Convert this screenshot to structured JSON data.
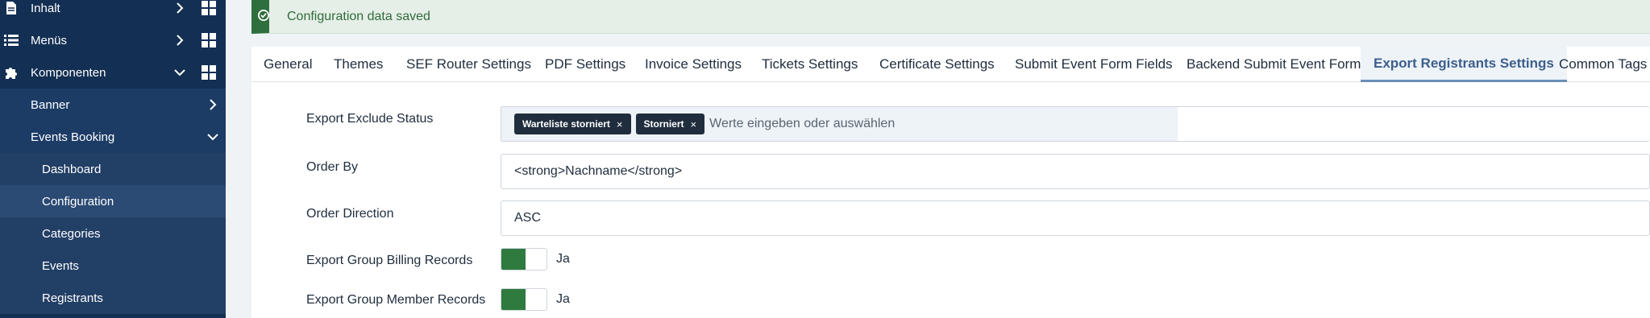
{
  "sidebar": {
    "items": [
      {
        "label": "Inhalt",
        "icon": "document-icon"
      },
      {
        "label": "Menüs",
        "icon": "list-icon"
      },
      {
        "label": "Komponenten",
        "icon": "puzzle-icon"
      }
    ],
    "sub_items": [
      {
        "label": "Banner"
      },
      {
        "label": "Events Booking"
      }
    ],
    "subsub_items": [
      {
        "label": "Dashboard"
      },
      {
        "label": "Configuration"
      },
      {
        "label": "Categories"
      },
      {
        "label": "Events"
      },
      {
        "label": "Registrants"
      }
    ]
  },
  "alert": {
    "message": "Configuration data saved"
  },
  "tabs": [
    {
      "label": "General"
    },
    {
      "label": "Themes"
    },
    {
      "label": "SEF Router Settings"
    },
    {
      "label": "PDF Settings"
    },
    {
      "label": "Invoice Settings"
    },
    {
      "label": "Tickets Settings"
    },
    {
      "label": "Certificate Settings"
    },
    {
      "label": "Submit Event Form Fields"
    },
    {
      "label": "Backend Submit Event Form"
    },
    {
      "label": "Export Registrants Settings"
    },
    {
      "label": "Common Tags"
    }
  ],
  "form": {
    "export_exclude_status": {
      "label": "Export Exclude Status",
      "chips": [
        "Warteliste storniert",
        "Storniert"
      ],
      "chip_remove": "×",
      "placeholder": "Werte eingeben oder auswählen"
    },
    "order_by": {
      "label": "Order By",
      "value": "<strong>Nachname</strong>"
    },
    "order_direction": {
      "label": "Order Direction",
      "value": "ASC"
    },
    "export_group_billing": {
      "label": "Export Group Billing Records",
      "value": "Ja"
    },
    "export_group_member": {
      "label": "Export Group Member Records",
      "value": "Ja"
    }
  },
  "colors": {
    "sidebar_bg": "#132f53",
    "accent": "#3c5f8c",
    "success": "#2f7a3e"
  }
}
